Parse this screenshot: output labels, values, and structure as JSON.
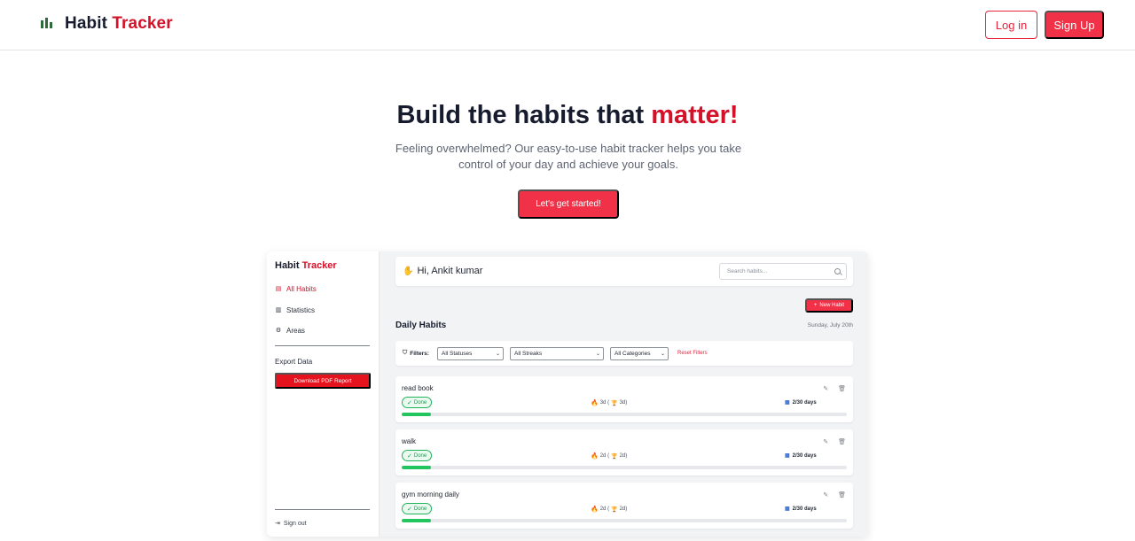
{
  "nav": {
    "brand_primary": "Habit",
    "brand_accent": "Tracker",
    "logo_caption": "HABIT TRACKER",
    "login_label": "Log in",
    "signup_label": "Sign Up"
  },
  "hero": {
    "title_main": "Build the habits that",
    "title_accent": "matter!",
    "subtitle": "Feeling overwhelmed? Our easy-to-use habit tracker helps you take control of your day and achieve your goals.",
    "cta_label": "Let's get started!"
  },
  "preview": {
    "sidebar": {
      "brand_primary": "Habit",
      "brand_accent": "Tracker",
      "items": [
        {
          "label": "All Habits",
          "icon": "clipboard-icon",
          "active": true
        },
        {
          "label": "Statistics",
          "icon": "chart-icon",
          "active": false
        },
        {
          "label": "Areas",
          "icon": "gears-icon",
          "active": false
        }
      ],
      "export_label": "Export Data",
      "download_label": "Download PDF Report",
      "signout_label": "Sign out"
    },
    "greeting": "Hi, Ankit kumar",
    "search_placeholder": "Search habits...",
    "new_habit_label": "New Habit",
    "section_title": "Daily Habits",
    "date": "Sunday, July 20th",
    "filters": {
      "label": "Filters:",
      "statuses": "All Statuses",
      "streaks": "All Streaks",
      "categories": "All Categories",
      "reset_label": "Reset Filters"
    },
    "habits": [
      {
        "name": "read book",
        "status": "Done",
        "streak": "3d",
        "best_streak": "3d",
        "days": "2/30 days",
        "progress": 0.0667
      },
      {
        "name": "walk",
        "status": "Done",
        "streak": "2d",
        "best_streak": "2d",
        "days": "2/30 days",
        "progress": 0.0667
      },
      {
        "name": "gym morning daily",
        "status": "Done",
        "streak": "2d",
        "best_streak": "2d",
        "days": "2/30 days",
        "progress": 0.0667
      }
    ],
    "colors": {
      "accent": "#d5112a",
      "button": "#f03147",
      "done_green": "#22c55e"
    }
  }
}
